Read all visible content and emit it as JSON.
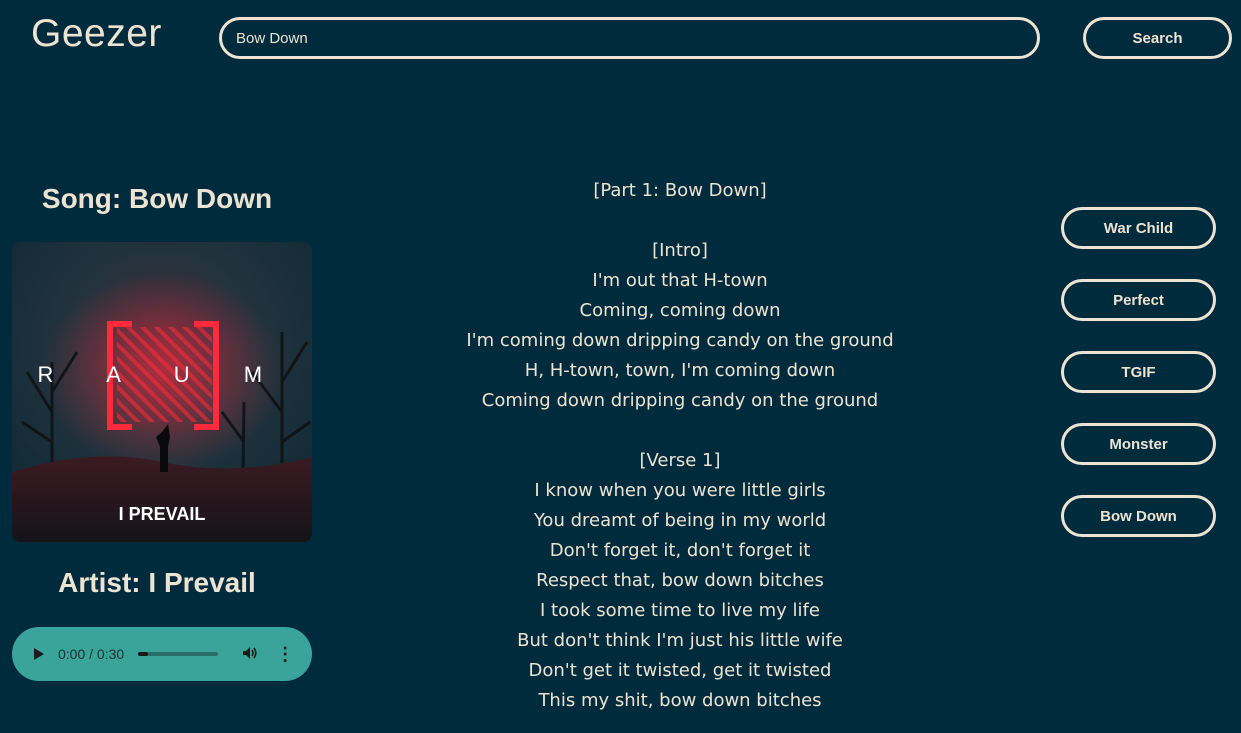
{
  "header": {
    "logo": "Geezer",
    "search_value": "Bow Down",
    "search_button": "Search"
  },
  "song": {
    "title": "Song: Bow Down",
    "artist": "Artist: I Prevail",
    "cover_text": "T R A U M A",
    "cover_band": "I PREVAIL"
  },
  "player": {
    "time": "0:00 / 0:30",
    "progress": 0.12
  },
  "lyrics": [
    "[Part 1: Bow Down]",
    "",
    "[Intro]",
    "I'm out that H-town",
    "Coming, coming down",
    "I'm coming down dripping candy on the ground",
    "H, H-town, town, I'm coming down",
    "Coming down dripping candy on the ground",
    "",
    "[Verse 1]",
    "I know when you were little girls",
    "You dreamt of being in my world",
    "Don't forget it, don't forget it",
    "Respect that, bow down bitches",
    "I took some time to live my life",
    "But don't think I'm just his little wife",
    "Don't get it twisted, get it twisted",
    "This my shit, bow down bitches"
  ],
  "related": [
    "War Child",
    "Perfect",
    "TGIF",
    "Monster",
    "Bow Down"
  ],
  "colors": {
    "background": "#002b3d",
    "text": "#ece3d2",
    "player": "#3aa39a",
    "neon": "#ff2a3a"
  }
}
